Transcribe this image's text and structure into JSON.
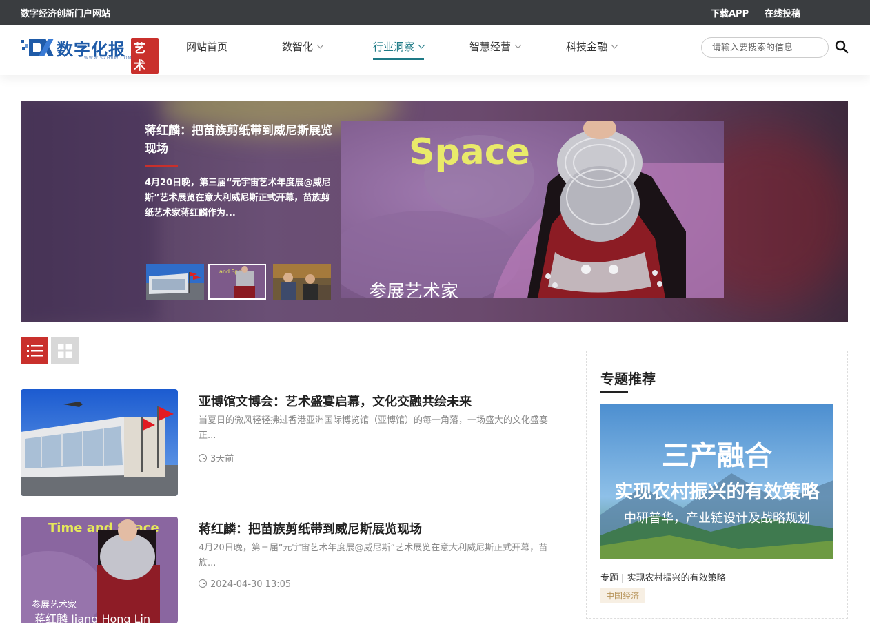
{
  "topbar": {
    "site_name": "数字经济创新门户网站",
    "download_app": "下载APP",
    "submit_online": "在线投稿"
  },
  "logo": {
    "text": "数字化报",
    "badge": "艺术",
    "url": "WWW.SZHBW.COM"
  },
  "nav": {
    "items": [
      {
        "label": "网站首页",
        "has_dropdown": false
      },
      {
        "label": "数智化",
        "has_dropdown": true
      },
      {
        "label": "行业洞察",
        "has_dropdown": true,
        "active": true
      },
      {
        "label": "智慧经营",
        "has_dropdown": true
      },
      {
        "label": "科技金融",
        "has_dropdown": true
      }
    ]
  },
  "search": {
    "placeholder": "请输入要搜索的信息",
    "value": ""
  },
  "carousel": {
    "title": "蒋红麟：把苗族剪纸带到威尼斯展览现场",
    "description": "4月20日晚，第三届“元宇宙艺术年度展@威尼斯”艺术展览在意大利威尼斯正式开幕，苗族剪纸艺术家蒋红麟作为...",
    "image_text_top": "Space",
    "image_text_bottom": "参展艺术家",
    "active_thumb_index": 1,
    "thumb_overlay": "and Space"
  },
  "articles": [
    {
      "title": "亚博馆文博会：艺术盛宴启幕，文化交融共绘未来",
      "description": "当夏日的微风轻轻拂过香港亚洲国际博览馆（亚博馆）的每一角落，一场盛大的文化盛宴正...",
      "time": "3天前"
    },
    {
      "title": "蒋红麟：把苗族剪纸带到威尼斯展览现场",
      "description": "4月20日晚，第三届“元宇宙艺术年度展@威尼斯”艺术展览在意大利威尼斯正式开幕，苗族...",
      "time": "2024-04-30 13:05",
      "thumb_text_top": "Time and Space",
      "thumb_text_bottom_1": "参展艺术家",
      "thumb_text_bottom_2": "蒋红麟 Jiang Hong Lin"
    }
  ],
  "sidebar": {
    "title": "专题推荐",
    "image_headline": "三产融合",
    "image_subheadline": "实现农村振兴的有效策略",
    "image_footer": "中研普华，产业链设计及战略规划",
    "caption": "专题 | 实现农村振兴的有效策略",
    "tag": "中国经济"
  },
  "colors": {
    "topbar_bg": "#3a3d40",
    "accent_red": "#c9302c",
    "nav_active": "#1e7a86",
    "logo_blue": "#1f5ba8"
  }
}
